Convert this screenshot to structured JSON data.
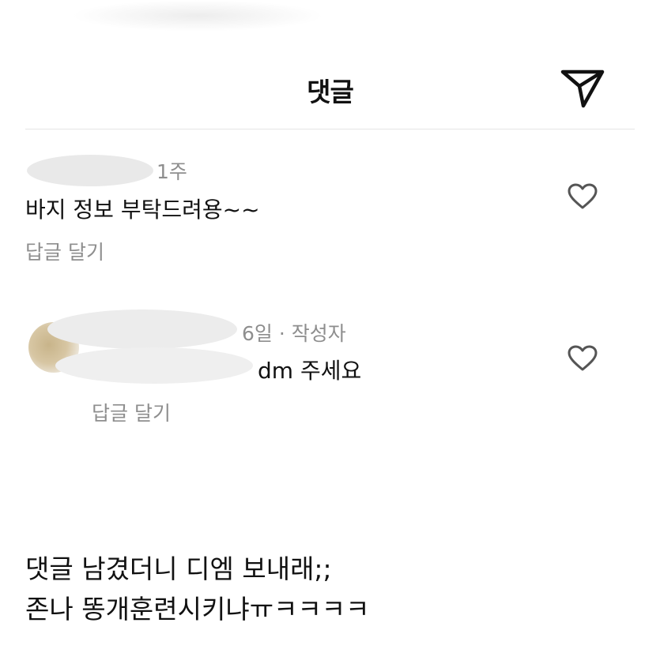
{
  "header": {
    "title": "댓글",
    "send_icon": "paper-plane-icon"
  },
  "comments": [
    {
      "time": "1주",
      "text": "바지 정보 부탁드려용~~",
      "reply_label": "답글 달기",
      "like_icon": "heart-outline-icon"
    },
    {
      "time_author": "6일 · 작성자",
      "text": "dm 주세요",
      "reply_label": "답글 달기",
      "like_icon": "heart-outline-icon"
    }
  ],
  "caption": {
    "line1": "댓글 남겼더니 디엠 보내래;;",
    "line2": "존나 똥개훈련시키냐ㅠㅋㅋㅋㅋ"
  }
}
